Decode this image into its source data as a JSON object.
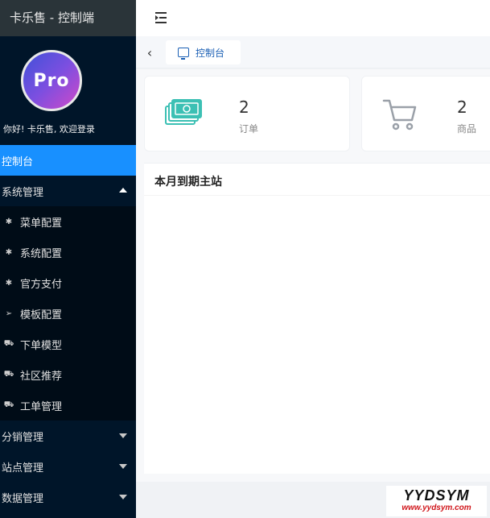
{
  "sidebar": {
    "app_title": "卡乐售 - 控制端",
    "avatar_text": "Pro",
    "welcome": "你好! 卡乐售, 欢迎登录",
    "active_item": "控制台",
    "groups": [
      {
        "label": "系统管理",
        "expanded": true
      },
      {
        "label": "分销管理",
        "expanded": false
      },
      {
        "label": "站点管理",
        "expanded": false
      },
      {
        "label": "数据管理",
        "expanded": false
      }
    ],
    "sub_items": [
      {
        "label": "菜单配置",
        "icon": "gear-icon"
      },
      {
        "label": "系统配置",
        "icon": "gear-icon"
      },
      {
        "label": "官方支付",
        "icon": "gear-icon"
      },
      {
        "label": "模板配置",
        "icon": "send-icon"
      },
      {
        "label": "下单模型",
        "icon": "car-icon"
      },
      {
        "label": "社区推荐",
        "icon": "car-icon"
      },
      {
        "label": "工单管理",
        "icon": "car-icon"
      }
    ]
  },
  "header": {
    "menu_toggle_icon": "menu-fold-icon"
  },
  "tabs": {
    "back_icon": "chevron-left-icon",
    "items": [
      {
        "label": "控制台",
        "icon": "monitor-icon"
      }
    ]
  },
  "stats": [
    {
      "value": "2",
      "label": "订单",
      "icon": "money-icon",
      "color": "#3cc0b4"
    },
    {
      "value": "2",
      "label": "商品",
      "icon": "cart-icon",
      "color": "#9aa0a8"
    }
  ],
  "panel": {
    "title": "本月到期主站"
  },
  "watermark": {
    "brand": "YYDSYM",
    "url": "www.yydsym.com"
  },
  "colors": {
    "sidebar_bg": "#001529",
    "active_bg": "#1890ff",
    "accent": "#1a5fb4"
  }
}
